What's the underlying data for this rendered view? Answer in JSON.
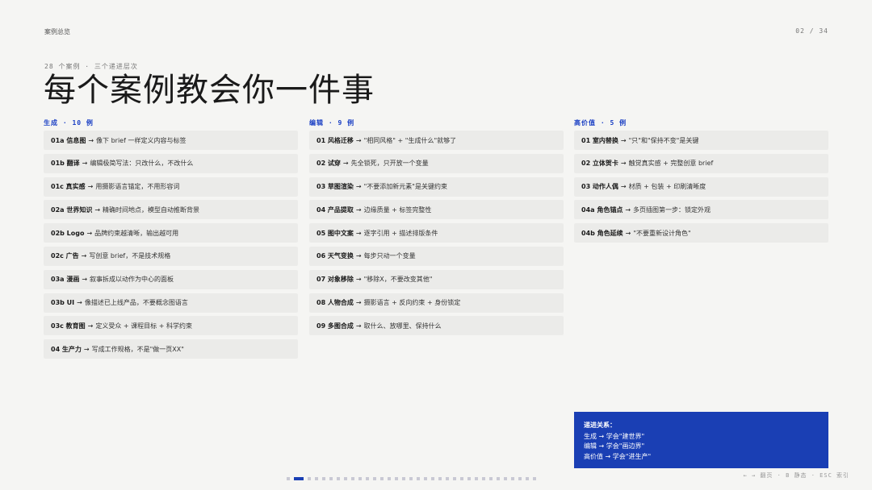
{
  "header": {
    "section": "案例总览",
    "page_indicator": "02 / 34"
  },
  "hero": {
    "subtitle": "28 个案例 · 三个递进层次",
    "title": "每个案例教会你一件事"
  },
  "columns": [
    {
      "heading": "生成 · 10 例",
      "items": [
        {
          "key": "01a 信息图",
          "text": "像下 brief 一样定义内容与标签"
        },
        {
          "key": "01b 翻译",
          "text": "编辑极简写法：只改什么，不改什么"
        },
        {
          "key": "01c 真实感",
          "text": "用摄影语言锚定，不用形容词"
        },
        {
          "key": "02a 世界知识",
          "text": "精确时间地点，模型自动推断背景"
        },
        {
          "key": "02b Logo",
          "text": "品牌约束越清晰，输出越可用"
        },
        {
          "key": "02c 广告",
          "text": "写创意 brief，不是技术规格"
        },
        {
          "key": "03a 漫画",
          "text": "叙事拆成以动作为中心的面板"
        },
        {
          "key": "03b UI",
          "text": "像描述已上线产品，不要概念图语言"
        },
        {
          "key": "03c 教育图",
          "text": "定义受众 + 课程目标 + 科学约束"
        },
        {
          "key": "04 生产力",
          "text": "写成工作规格，不是\"做一页XX\""
        }
      ]
    },
    {
      "heading": "编辑 · 9 例",
      "items": [
        {
          "key": "01 风格迁移",
          "text": "\"相同风格\" + \"生成什么\"就够了"
        },
        {
          "key": "02 试穿",
          "text": "先全锁死，只开放一个变量"
        },
        {
          "key": "03 草图渲染",
          "text": "\"不要添加新元素\"是关键约束"
        },
        {
          "key": "04 产品提取",
          "text": "边缘质量 + 标签完整性"
        },
        {
          "key": "05 图中文案",
          "text": "逐字引用 + 描述排版条件"
        },
        {
          "key": "06 天气变换",
          "text": "每步只动一个变量"
        },
        {
          "key": "07 对象移除",
          "text": "\"移除X，不要改变其他\""
        },
        {
          "key": "08 人物合成",
          "text": "摄影语言 + 反向约束 + 身份锁定"
        },
        {
          "key": "09 多图合成",
          "text": "取什么、放哪里、保持什么"
        }
      ]
    },
    {
      "heading": "高价值 · 5 例",
      "items": [
        {
          "key": "01 室内替换",
          "text": "\"只\"和\"保持不变\"是关键"
        },
        {
          "key": "02 立体贺卡",
          "text": "触觉真实感 + 完整创意 brief"
        },
        {
          "key": "03 动作人偶",
          "text": "材质 + 包装 + 印刷清晰度"
        },
        {
          "key": "04a 角色锚点",
          "text": "多页插图第一步：锁定外观"
        },
        {
          "key": "04b 角色延续",
          "text": "\"不要重新设计角色\""
        }
      ]
    }
  ],
  "arrow": "→",
  "note": {
    "title": "递进关系：",
    "lines": [
      "生成 → 学会\"建世界\"",
      "编辑 → 学会\"画边界\"",
      "高价值 → 学会\"进生产\""
    ]
  },
  "nav_hint": "← → 翻页 · B 静态 · ESC 索引",
  "pager": {
    "current": 2,
    "total": 34
  },
  "colors": {
    "accent": "#1a3fb4",
    "background": "#f5f5f3",
    "card": "#ebebe9"
  }
}
